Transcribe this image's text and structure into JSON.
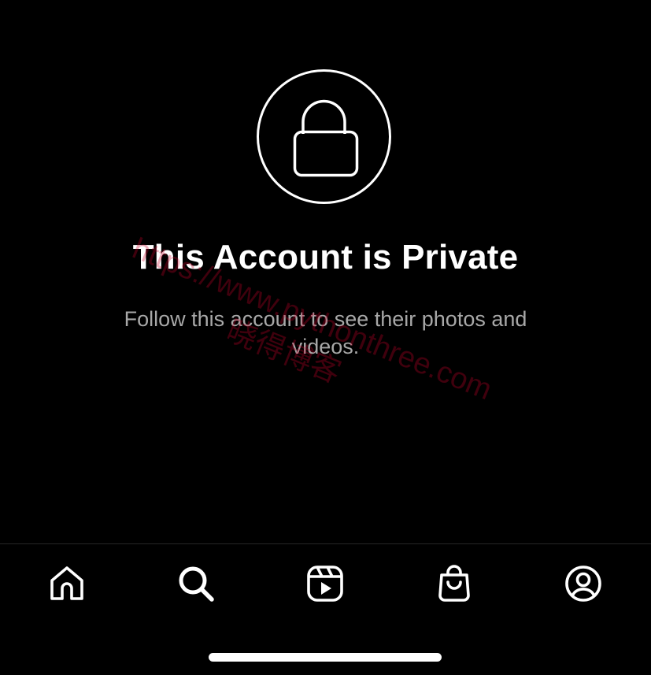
{
  "private_notice": {
    "title": "This Account is Private",
    "subtitle": "Follow this account to see their photos and videos.",
    "icon": "lock-icon"
  },
  "watermark": {
    "line1": "https://www.pythonthree.com",
    "line2": "晓得博客"
  },
  "tab_bar": {
    "items": [
      {
        "name": "home",
        "icon": "home-icon"
      },
      {
        "name": "search",
        "icon": "search-icon"
      },
      {
        "name": "reels",
        "icon": "reels-icon"
      },
      {
        "name": "shop",
        "icon": "shopping-bag-icon"
      },
      {
        "name": "profile",
        "icon": "profile-icon"
      }
    ]
  },
  "colors": {
    "background": "#000000",
    "foreground": "#ffffff",
    "secondary_text": "#a8a8a8",
    "divider": "#262626"
  }
}
